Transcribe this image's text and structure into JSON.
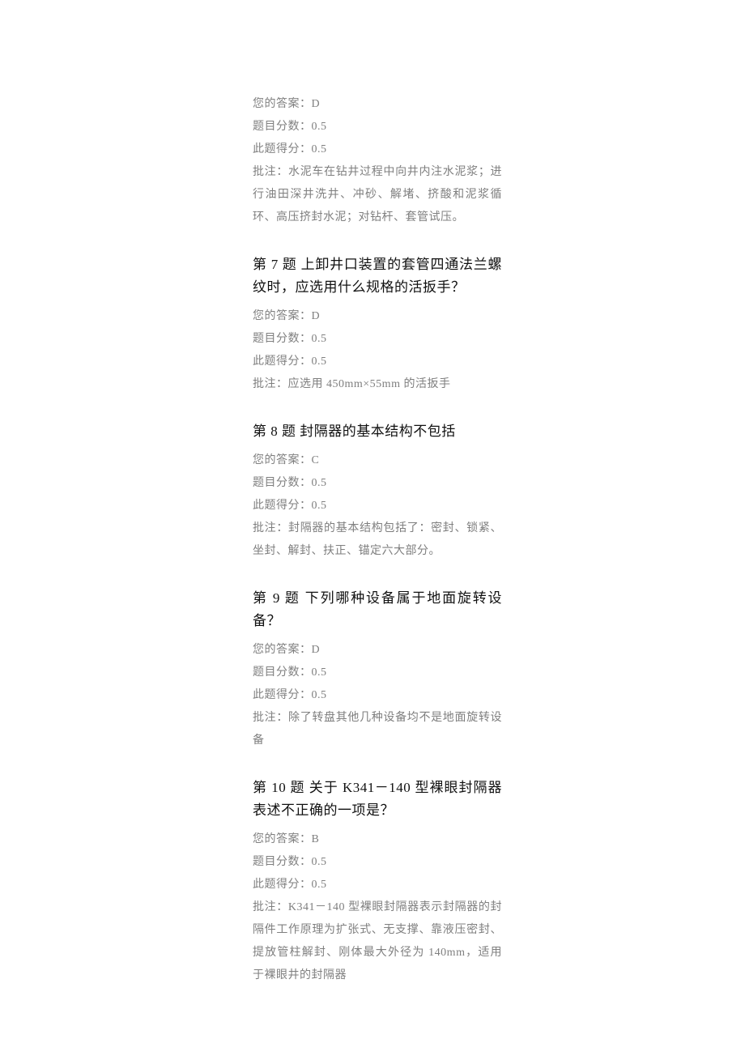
{
  "labels": {
    "your_answer": "您的答案：",
    "question_score": "题目分数：",
    "earned_score": "此题得分：",
    "note": "批注："
  },
  "q6_tail": {
    "your_answer": "D",
    "question_score": "0.5",
    "earned_score": "0.5",
    "note": "水泥车在钻井过程中向井内注水泥浆；进行油田深井洗井、冲砂、解堵、挤酸和泥浆循环、高压挤封水泥；对钻杆、套管试压。"
  },
  "q7": {
    "title": "第 7 题  上卸井口装置的套管四通法兰螺纹时，应选用什么规格的活扳手？",
    "your_answer": "D",
    "question_score": "0.5",
    "earned_score": "0.5",
    "note": "应选用 450mm×55mm 的活扳手"
  },
  "q8": {
    "title": "第 8 题  封隔器的基本结构不包括",
    "your_answer": "C",
    "question_score": "0.5",
    "earned_score": "0.5",
    "note": "封隔器的基本结构包括了：密封、锁紧、坐封、解封、扶正、锚定六大部分。"
  },
  "q9": {
    "title": "第 9 题  下列哪种设备属于地面旋转设备？",
    "your_answer": "D",
    "question_score": "0.5",
    "earned_score": "0.5",
    "note": "除了转盘其他几种设备均不是地面旋转设备"
  },
  "q10": {
    "title": "第 10 题 关于 K341－140 型裸眼封隔器表述不正确的一项是？",
    "your_answer": "B",
    "question_score": "0.5",
    "earned_score": "0.5",
    "note": "K341－140 型裸眼封隔器表示封隔器的封隔件工作原理为扩张式、无支撑、靠液压密封、提放管柱解封、刚体最大外径为 140mm，适用于裸眼井的封隔器"
  }
}
